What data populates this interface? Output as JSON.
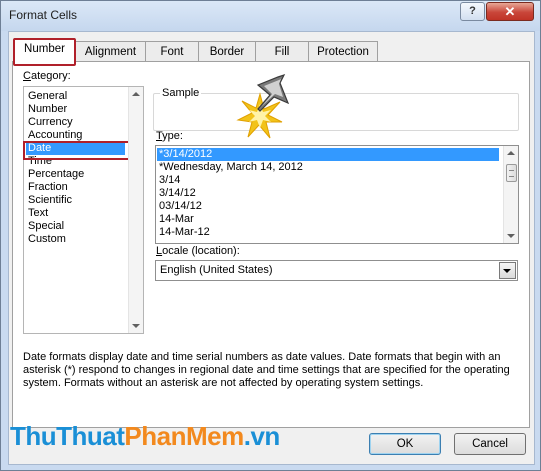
{
  "window": {
    "title": "Format Cells",
    "help": "?",
    "close": "✕"
  },
  "tabs": [
    {
      "label": "Number",
      "active": true
    },
    {
      "label": "Alignment"
    },
    {
      "label": "Font"
    },
    {
      "label": "Border"
    },
    {
      "label": "Fill"
    },
    {
      "label": "Protection"
    }
  ],
  "category": {
    "label_prefix": "C",
    "label_rest": "ategory:",
    "items": [
      "General",
      "Number",
      "Currency",
      "Accounting",
      "Date",
      "Time",
      "Percentage",
      "Fraction",
      "Scientific",
      "Text",
      "Special",
      "Custom"
    ],
    "selected": "Date"
  },
  "sample": {
    "label": "Sample",
    "value": ""
  },
  "type": {
    "label_prefix": "T",
    "label_rest": "ype:",
    "items": [
      "*3/14/2012",
      "*Wednesday, March 14, 2012",
      "3/14",
      "3/14/12",
      "03/14/12",
      "14-Mar",
      "14-Mar-12"
    ],
    "selected": "*3/14/2012"
  },
  "locale": {
    "label_prefix": "L",
    "label_rest": "ocale (location):",
    "value": "English (United States)"
  },
  "description": "Date formats display date and time serial numbers as date values.  Date formats that begin with an asterisk (*) respond to changes in regional date and time settings that are specified for the operating system. Formats without an asterisk are not affected by operating system settings.",
  "buttons": {
    "ok": "OK",
    "cancel": "Cancel"
  },
  "watermark": {
    "part1": "ThuThuat",
    "part2": "PhanMem",
    "part3": ".vn"
  },
  "colors": {
    "selection": "#3399ff",
    "highlight_box": "#b0202a",
    "title_bg": "#c9daf0"
  }
}
